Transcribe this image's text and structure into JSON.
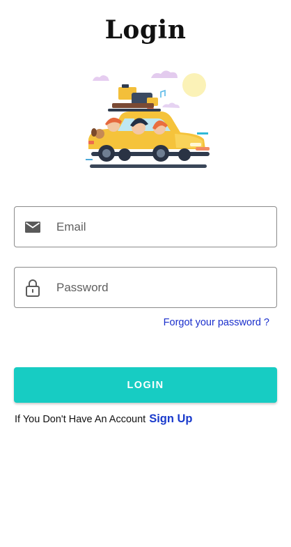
{
  "page": {
    "title": "Login"
  },
  "illustration": {
    "name": "family-car-trip-illustration"
  },
  "form": {
    "email": {
      "icon": "mail-icon",
      "placeholder": "Email",
      "value": ""
    },
    "password": {
      "icon": "lock-icon",
      "placeholder": "Password",
      "value": ""
    },
    "forgot_label": "Forgot your password ?",
    "login_label": "LOGIN"
  },
  "signup": {
    "prompt": "If You Don't Have An Account",
    "link_label": "Sign Up"
  },
  "colors": {
    "accent": "#17ccc3",
    "link": "#1a2fcc",
    "field_border": "#8a8a8a"
  }
}
